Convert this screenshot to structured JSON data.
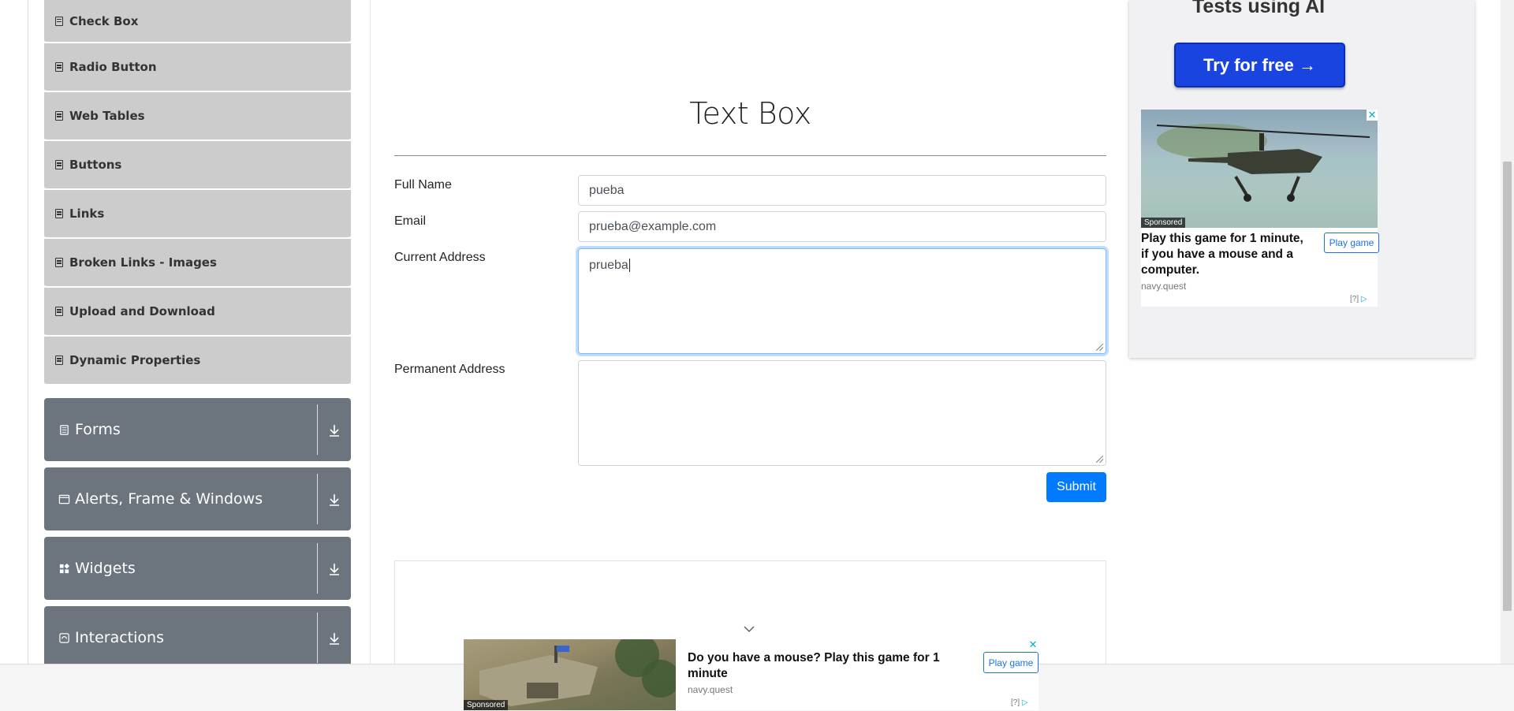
{
  "sidebar": {
    "sub_items": [
      {
        "label": "Check Box"
      },
      {
        "label": "Radio Button"
      },
      {
        "label": "Web Tables"
      },
      {
        "label": "Buttons"
      },
      {
        "label": "Links"
      },
      {
        "label": "Broken Links - Images"
      },
      {
        "label": "Upload and Download"
      },
      {
        "label": "Dynamic Properties"
      }
    ],
    "groups": [
      {
        "label": "Forms",
        "icon": "document-icon"
      },
      {
        "label": "Alerts, Frame & Windows",
        "icon": "window-icon"
      },
      {
        "label": "Widgets",
        "icon": "widgets-icon"
      },
      {
        "label": "Interactions",
        "icon": "interactions-icon"
      }
    ]
  },
  "main": {
    "title": "Text Box",
    "form": {
      "full_name_label": "Full Name",
      "full_name_value": "pueba",
      "email_label": "Email",
      "email_value": "prueba@example.com",
      "current_address_label": "Current Address",
      "current_address_value": "prueba",
      "permanent_address_label": "Permanent Address",
      "permanent_address_value": "",
      "submit_label": "Submit"
    }
  },
  "right_ad": {
    "headline": "Tests using AI",
    "cta": "Try for free →",
    "sponsored": "Sponsored",
    "text": "Play this game for 1 minute, if you have a mouse and a computer.",
    "button": "Play game",
    "domain": "navy.quest",
    "adchoices": "[?]",
    "close": "✕"
  },
  "bottom_ad": {
    "sponsored": "Sponsored",
    "text": "Do you have a mouse? Play this game for 1 minute",
    "button": "Play game",
    "domain": "navy.quest",
    "adchoices": "[?]",
    "close": "✕"
  },
  "colors": {
    "primary": "#007bff",
    "sidebar_group": "#6c757d",
    "sidebar_item": "#cccccc",
    "ad_cta": "#1a44e0"
  }
}
